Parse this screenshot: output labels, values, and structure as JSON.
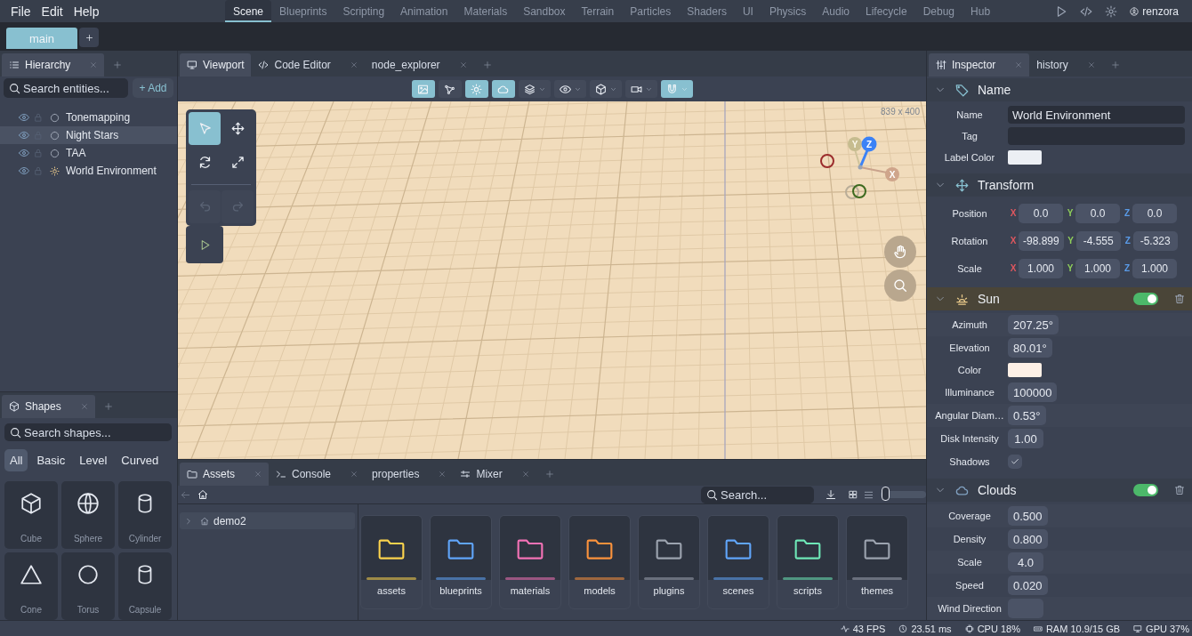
{
  "menu": [
    "File",
    "Edit",
    "Help"
  ],
  "workspaces": [
    {
      "label": "Scene",
      "selected": true
    },
    {
      "label": "Blueprints",
      "selected": false
    },
    {
      "label": "Scripting",
      "selected": false
    },
    {
      "label": "Animation",
      "selected": false
    },
    {
      "label": "Materials",
      "selected": false
    },
    {
      "label": "Sandbox",
      "selected": false
    },
    {
      "label": "Terrain",
      "selected": false
    },
    {
      "label": "Particles",
      "selected": false
    },
    {
      "label": "Shaders",
      "selected": false
    },
    {
      "label": "UI",
      "selected": false
    },
    {
      "label": "Physics",
      "selected": false
    },
    {
      "label": "Audio",
      "selected": false
    },
    {
      "label": "Lifecycle",
      "selected": false
    },
    {
      "label": "Debug",
      "selected": false
    },
    {
      "label": "Hub",
      "selected": false
    }
  ],
  "account": {
    "user": "renzora"
  },
  "scene_tabs": [
    {
      "label": "main",
      "selected": true
    }
  ],
  "hierarchy": {
    "tab": {
      "label": "Hierarchy",
      "selected": true
    },
    "search_placeholder": "Search entities...",
    "add_button": "+ Add",
    "entities": [
      {
        "name": "Tonemapping",
        "kind": "node",
        "hovered": false
      },
      {
        "name": "Night Stars",
        "kind": "node",
        "hovered": true
      },
      {
        "name": "TAA",
        "kind": "node",
        "hovered": false
      },
      {
        "name": "World Environment",
        "kind": "environment",
        "hovered": false
      }
    ]
  },
  "shapes": {
    "tab": {
      "label": "Shapes",
      "selected": true
    },
    "search_placeholder": "Search shapes...",
    "filters": [
      {
        "label": "All",
        "selected": true
      },
      {
        "label": "Basic",
        "selected": false
      },
      {
        "label": "Level",
        "selected": false
      },
      {
        "label": "Curved",
        "selected": false
      }
    ],
    "items": [
      {
        "label": "Cube",
        "kind": "cube"
      },
      {
        "label": "Sphere",
        "kind": "sphere"
      },
      {
        "label": "Cylinder",
        "kind": "cylinder"
      },
      {
        "label": "Cone",
        "kind": "cone"
      },
      {
        "label": "Torus",
        "kind": "torus"
      },
      {
        "label": "Capsule",
        "kind": "capsule"
      }
    ]
  },
  "editor_tabs": [
    {
      "label": "Viewport",
      "kind": "viewport",
      "selected": true,
      "closable": false
    },
    {
      "label": "Code Editor",
      "kind": "code",
      "selected": false,
      "closable": true
    },
    {
      "label": "node_explorer",
      "kind": "plain",
      "selected": false,
      "closable": true
    }
  ],
  "viewport_toolbar": [
    {
      "kind": "image",
      "on": true,
      "dropdown": false
    },
    {
      "kind": "graph",
      "on": false,
      "dropdown": false
    },
    {
      "kind": "sun",
      "on": true,
      "dropdown": false
    },
    {
      "kind": "cloud",
      "on": true,
      "dropdown": false
    },
    {
      "kind": "layers",
      "on": false,
      "dropdown": true
    },
    {
      "kind": "eye",
      "on": false,
      "dropdown": true
    },
    {
      "kind": "cube",
      "on": false,
      "dropdown": true
    },
    {
      "kind": "camera",
      "on": false,
      "dropdown": true
    },
    {
      "kind": "magnet",
      "on": true,
      "dropdown": true
    }
  ],
  "viewport": {
    "size": "839 x 400",
    "tools": [
      {
        "kind": "select",
        "selected": true
      },
      {
        "kind": "move",
        "selected": false
      },
      {
        "kind": "rotate",
        "selected": false
      },
      {
        "kind": "scale",
        "selected": false
      }
    ],
    "history": [
      {
        "kind": "undo",
        "disabled": true
      },
      {
        "kind": "redo",
        "disabled": true
      }
    ],
    "axes": [
      {
        "label": "Y"
      },
      {
        "label": "Z"
      },
      {
        "label": "X"
      }
    ]
  },
  "bottom_tabs": [
    {
      "label": "Assets",
      "kind": "folder",
      "selected": true,
      "closable": true
    },
    {
      "label": "Console",
      "kind": "terminal",
      "selected": false,
      "closable": true
    },
    {
      "label": "properties",
      "kind": "plain",
      "selected": false,
      "closable": true
    },
    {
      "label": "Mixer",
      "kind": "sliders",
      "selected": false,
      "closable": true
    }
  ],
  "assets": {
    "search_placeholder": "Search...",
    "size_slider": {
      "level": 0.1
    },
    "tree": [
      {
        "label": "demo2",
        "expanded": false
      }
    ],
    "folders": [
      {
        "name": "assets",
        "color": "#fcd34d"
      },
      {
        "name": "blueprints",
        "color": "#60a5fa"
      },
      {
        "name": "materials",
        "color": "#f472b6"
      },
      {
        "name": "models",
        "color": "#fb923c"
      },
      {
        "name": "plugins",
        "color": "#9ca3af"
      },
      {
        "name": "scenes",
        "color": "#60a5fa"
      },
      {
        "name": "scripts",
        "color": "#6ee7b7"
      },
      {
        "name": "themes",
        "color": "#9ca3af"
      }
    ]
  },
  "inspector_tabs": [
    {
      "label": "Inspector",
      "kind": "slidersv",
      "selected": true
    },
    {
      "label": "history",
      "kind": "plain",
      "selected": false
    }
  ],
  "sections": [
    {
      "title": "Name",
      "kind": "tag",
      "expanded": true,
      "highlighted": false,
      "removable": false,
      "rows": [
        {
          "label": "Name",
          "kind": "text",
          "value": "World Environment"
        },
        {
          "label": "Tag",
          "kind": "text"
        },
        {
          "label": "Label Color",
          "kind": "color",
          "color": "#eceff4"
        }
      ]
    },
    {
      "title": "Transform",
      "kind": "move",
      "expanded": true,
      "highlighted": false,
      "removable": false,
      "rows": [
        {
          "label": "Position",
          "kind": "vector",
          "components": [
            {
              "axis": "X",
              "value": "0.0"
            },
            {
              "axis": "Y",
              "value": "0.0"
            },
            {
              "axis": "Z",
              "value": "0.0"
            }
          ]
        },
        {
          "label": "Rotation",
          "kind": "vector",
          "components": [
            {
              "axis": "X",
              "value": "-98.899"
            },
            {
              "axis": "Y",
              "value": "-4.555"
            },
            {
              "axis": "Z",
              "value": "-5.323"
            }
          ]
        },
        {
          "label": "Scale",
          "kind": "vector",
          "components": [
            {
              "axis": "X",
              "value": "1.000"
            },
            {
              "axis": "Y",
              "value": "1.000"
            },
            {
              "axis": "Z",
              "value": "1.000"
            }
          ]
        }
      ]
    },
    {
      "title": "Sun",
      "kind": "sunrise",
      "expanded": true,
      "highlighted": true,
      "removable": true,
      "enabled": true,
      "rows": [
        {
          "label": "Azimuth",
          "kind": "number",
          "value": "207.25°"
        },
        {
          "label": "Elevation",
          "kind": "number",
          "value": "80.01°"
        },
        {
          "label": "Color",
          "kind": "color",
          "color": "#fdf0e6"
        },
        {
          "label": "Illuminance",
          "kind": "number",
          "value": "100000"
        },
        {
          "label": "Angular Diam…",
          "kind": "number",
          "value": "0.53°"
        },
        {
          "label": "Disk Intensity",
          "kind": "number",
          "value": "1.00"
        },
        {
          "label": "Shadows",
          "kind": "checkbox",
          "checked": true
        }
      ]
    },
    {
      "title": "Clouds",
      "kind": "cloud",
      "expanded": true,
      "highlighted": false,
      "removable": true,
      "enabled": true,
      "rows": [
        {
          "label": "Coverage",
          "kind": "number",
          "value": "0.500"
        },
        {
          "label": "Density",
          "kind": "number",
          "value": "0.800"
        },
        {
          "label": "Scale",
          "kind": "number",
          "value": "4.0"
        },
        {
          "label": "Speed",
          "kind": "number",
          "value": "0.020"
        },
        {
          "label": "Wind Direction",
          "kind": "number"
        }
      ]
    }
  ],
  "status": [
    {
      "kind": "pulse",
      "text": "43 FPS"
    },
    {
      "kind": "clock",
      "text": "23.51 ms"
    },
    {
      "kind": "cpu",
      "text": "CPU 18%"
    },
    {
      "kind": "ram",
      "text": "RAM 10.9/15 GB"
    },
    {
      "kind": "gpu",
      "text": "GPU 37%"
    }
  ]
}
